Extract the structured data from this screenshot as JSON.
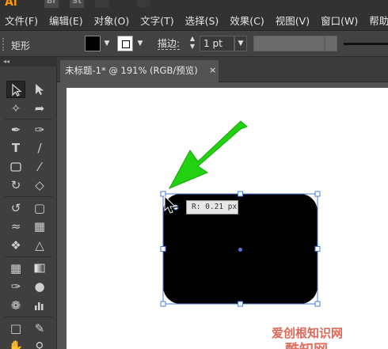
{
  "app": {
    "logo": "Ai",
    "bridge": "Br",
    "stock": "St"
  },
  "menu": [
    "文件(F)",
    "编辑(E)",
    "对象(O)",
    "文字(T)",
    "选择(S)",
    "效果(C)",
    "视图(V)",
    "窗口(W)",
    "帮助(H)"
  ],
  "control_bar": {
    "object_type": "矩形",
    "fill_color": "#000000",
    "stroke_color": "#ffffff",
    "stroke_label": "描边:",
    "stroke_weight": "1 pt"
  },
  "tool_panel": {
    "collapse_glyph": "◂◂",
    "tools": [
      "selection-tool",
      "direct-selection-tool",
      "magic-wand-tool",
      "lasso-tool",
      "pen-tool",
      "curvature-tool",
      "type-tool",
      "line-segment-tool",
      "rectangle-tool",
      "paintbrush-tool",
      "shaper-tool",
      "eraser-tool",
      "rotate-tool",
      "scale-tool",
      "width-tool",
      "free-transform-tool",
      "shape-builder-tool",
      "perspective-grid-tool",
      "mesh-tool",
      "gradient-tool",
      "eyedropper-tool",
      "blend-tool",
      "symbol-sprayer-tool",
      "column-graph-tool",
      "artboard-tool",
      "slice-tool",
      "hand-tool",
      "zoom-tool"
    ]
  },
  "document_tab": {
    "title": "未标题-1* @ 191% (RGB/预览)",
    "close_glyph": "×"
  },
  "canvas": {
    "artboard_color": "#ffffff",
    "shape_fill": "#000000",
    "selection_color": "#4a7bd8",
    "arrow_color": "#22d10f",
    "corner_radius_tooltip": "R: 0.21 px"
  },
  "watermark": {
    "line1": "爱创根知识网",
    "line2": "酷知网"
  }
}
